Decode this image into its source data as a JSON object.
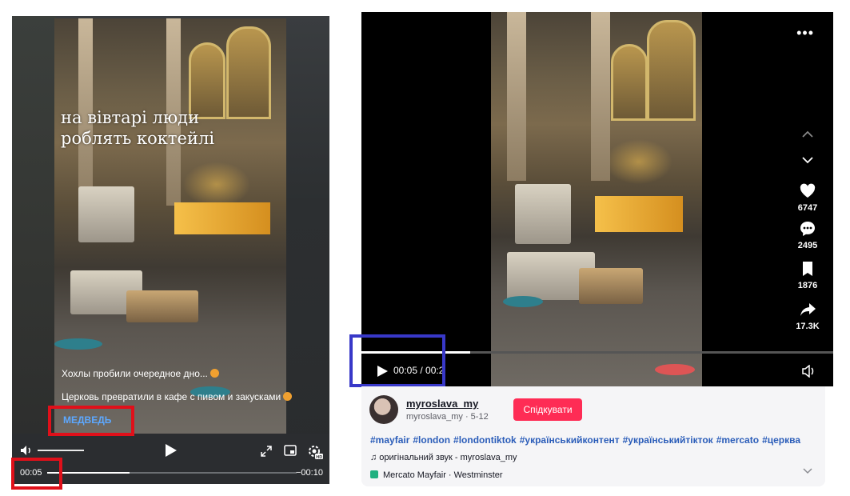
{
  "left_player": {
    "caption": "на вівтарі люди роблять коктейлі",
    "description_line1": "Хохлы пробили очередное дно...",
    "description_line2": "Церковь превратили в кафе с пивом и закусками",
    "author": "МЕДВЕДЬ",
    "time_current": "00:05",
    "time_remaining": "−00:10",
    "progress": 0.33,
    "icons": [
      "volume-icon",
      "play-icon",
      "fullscreen-icon",
      "picture-in-picture-icon",
      "settings-hd-icon"
    ]
  },
  "right_player": {
    "time": "00:05 / 00:2",
    "progress": 0.23,
    "actions": {
      "likes": "6747",
      "comments": "2495",
      "saves": "1876",
      "shares": "17.3K"
    },
    "icons": [
      "more-icon",
      "chevron-up-icon",
      "chevron-down-icon",
      "heart-icon",
      "comment-icon",
      "bookmark-icon",
      "share-icon",
      "play-icon",
      "speaker-icon"
    ]
  },
  "info": {
    "username": "myroslava_my",
    "subline": "myroslava_my · 5-12",
    "follow_label": "Спідкувати",
    "hashtags": [
      "#mayfair",
      "#london",
      "#londontiktok",
      "#українськийконтент",
      "#українськийтікток",
      "#mercato",
      "#церква"
    ],
    "sound": "♫ оригінальний звук - myroslava_my",
    "location": "Mercato Mayfair · Westminster"
  },
  "colors": {
    "highlight_red": "#e0101a",
    "highlight_blue": "#3838c8",
    "follow_button": "#fe2c55",
    "hashtag": "#2b5db9",
    "author_link": "#5da8ff"
  }
}
